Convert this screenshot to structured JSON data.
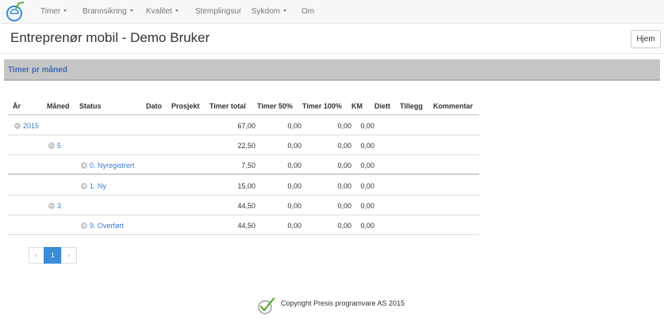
{
  "nav": {
    "items": [
      {
        "label": "Timer",
        "dropdown": true
      },
      {
        "label": "Brannsikring",
        "dropdown": true
      },
      {
        "label": "Kvalitet",
        "dropdown": true
      },
      {
        "label": "Stemplingsur",
        "dropdown": false
      },
      {
        "label": "Sykdom",
        "dropdown": true
      },
      {
        "label": "Om",
        "dropdown": false
      }
    ]
  },
  "header": {
    "title": "Entreprenør mobil - Demo Bruker",
    "home_label": "Hjem"
  },
  "panel": {
    "title": "Timer pr måned"
  },
  "table": {
    "columns": [
      "År",
      "Måned",
      "Status",
      "Dato",
      "Prosjekt",
      "Timer total",
      "Timer 50%",
      "Timer 100%",
      "KM",
      "Diett",
      "Tillegg",
      "Kommentar"
    ],
    "rows": [
      {
        "label": "2015",
        "timer_total": "67,00",
        "timer_50": "0,00",
        "timer_100": "0,00",
        "km": "0,00"
      },
      {
        "label": "5",
        "timer_total": "22,50",
        "timer_50": "0,00",
        "timer_100": "0,00",
        "km": "0,00"
      },
      {
        "label": "0. Nyregistrert",
        "timer_total": "7,50",
        "timer_50": "0,00",
        "timer_100": "0,00",
        "km": "0,00"
      },
      {
        "label": "1. Ny",
        "timer_total": "15,00",
        "timer_50": "0,00",
        "timer_100": "0,00",
        "km": "0,00"
      },
      {
        "label": "3",
        "timer_total": "44,50",
        "timer_50": "0,00",
        "timer_100": "0,00",
        "km": "0,00"
      },
      {
        "label": "9. Overført",
        "timer_total": "44,50",
        "timer_50": "0,00",
        "timer_100": "0,00",
        "km": "0,00"
      }
    ]
  },
  "pagination": {
    "prev": "‹",
    "current": "1",
    "next": "›"
  },
  "footer": {
    "copyright": "Copyright Presis programvare AS 2015"
  },
  "colors": {
    "navbar_bg": "#f8f8f8",
    "panel_bg": "#c6c6c6",
    "panel_title": "#3f6bb1",
    "link": "#3a7bd5",
    "pager_active": "#3a8dd6",
    "logo_check": "#5aa82e"
  }
}
